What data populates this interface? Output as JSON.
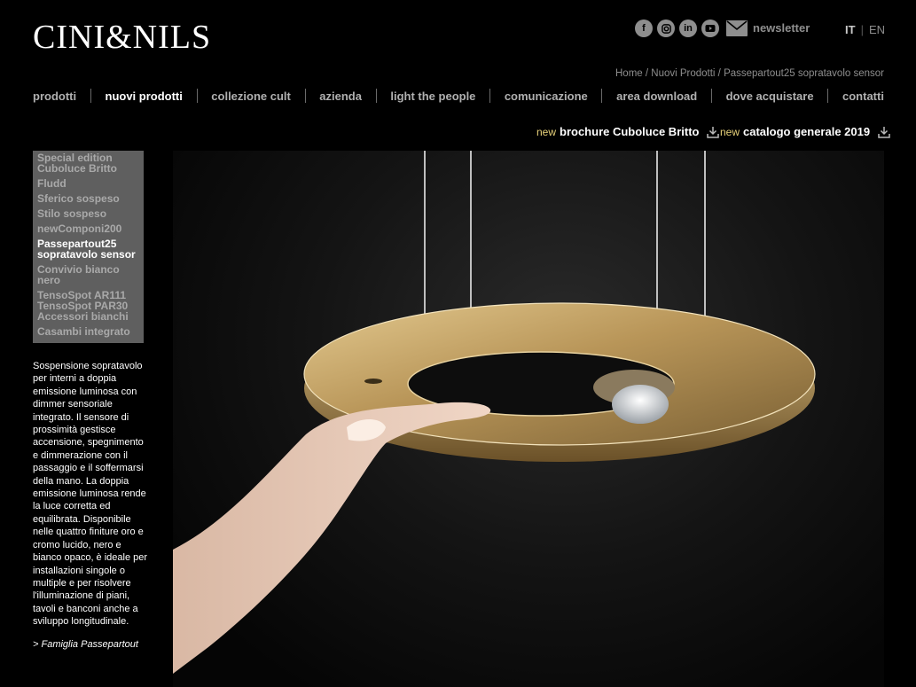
{
  "brand": {
    "logo_text": "CINI&NILS"
  },
  "social": {
    "icons": [
      "facebook-icon",
      "instagram-icon",
      "linkedin-icon",
      "youtube-icon",
      "mail-icon"
    ],
    "newsletter_label": "newsletter"
  },
  "language": {
    "it": "IT",
    "separator": "|",
    "en": "EN",
    "active": "IT"
  },
  "breadcrumb": "Home / Nuovi Prodotti / Passepartout25 sopratavolo sensor",
  "nav": {
    "items": [
      {
        "label": "prodotti"
      },
      {
        "label": "nuovi prodotti"
      },
      {
        "label": "collezione cult"
      },
      {
        "label": "azienda"
      },
      {
        "label": "light the people"
      },
      {
        "label": "comunicazione"
      },
      {
        "label": "area download"
      },
      {
        "label": "dove acquistare"
      },
      {
        "label": "contatti"
      }
    ],
    "current": "nuovi prodotti"
  },
  "downloads": [
    {
      "badge": "new",
      "label": "brochure Cuboluce Britto"
    },
    {
      "badge": "new",
      "label": "catalogo generale 2019"
    }
  ],
  "product_menu": {
    "items": [
      {
        "label": "Special edition Cuboluce Britto"
      },
      {
        "label": "Fludd"
      },
      {
        "label": "Sferico sospeso"
      },
      {
        "label": "Stilo sospeso"
      },
      {
        "label": "newComponi200"
      },
      {
        "label": "Passepartout25 sopratavolo sensor"
      },
      {
        "label": "Convivio bianco nero"
      },
      {
        "label": "TensoSpot AR111 TensoSpot PAR30 Accessori bianchi"
      },
      {
        "label": "Casambi integrato"
      }
    ],
    "selected": "Passepartout25 sopratavolo sensor"
  },
  "description": "Sospensione sopratavolo per interni a doppia emissione luminosa con dimmer sensoriale integrato. Il sensore di prossimità gestisce accensione, spegnimento e dimmerazione con il passaggio e il soffermarsi della mano. La doppia emissione luminosa rende la luce corretta ed equilibrata. Disponibile nelle quattro finiture oro e cromo lucido, nero e bianco opaco, è ideale per installazioni singole o multiple e per risolvere l'illuminazione di piani, tavoli e banconi anche a sviluppo longitudinale.",
  "family_link": "> Famiglia Passepartout",
  "colors": {
    "background": "#000000",
    "accent_new": "#e8d27a",
    "menu_bg": "#5f5f5f",
    "gold": "#c9a86a"
  }
}
